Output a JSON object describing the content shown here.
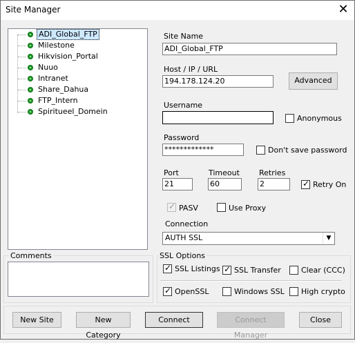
{
  "window": {
    "title": "Site Manager",
    "close_glyph": "✕"
  },
  "tree": {
    "items": [
      {
        "label": "ADI_Global_FTP",
        "selected": true
      },
      {
        "label": "Milestone"
      },
      {
        "label": "Hikvision_Portal"
      },
      {
        "label": "Nuuo"
      },
      {
        "label": "Intranet"
      },
      {
        "label": "Share_Dahua"
      },
      {
        "label": "FTP_Intern"
      },
      {
        "label": "Spiritueel_Domein"
      }
    ]
  },
  "form": {
    "site_name_label": "Site Name",
    "site_name_value": "ADI_Global_FTP",
    "host_label": "Host / IP / URL",
    "host_value": "194.178.124.20",
    "advanced_label": "Advanced",
    "username_label": "Username",
    "username_value": "",
    "anonymous_label": "Anonymous",
    "password_label": "Password",
    "password_value": "*************",
    "dont_save_password_label": "Don't save password",
    "port_label": "Port",
    "port_value": "21",
    "timeout_label": "Timeout",
    "timeout_value": "60",
    "retries_label": "Retries",
    "retries_value": "2",
    "retry_on_label": "Retry On",
    "pasv_label": "PASV",
    "use_proxy_label": "Use Proxy",
    "connection_label": "Connection",
    "connection_value": "AUTH SSL"
  },
  "comments": {
    "label": "Comments",
    "value": ""
  },
  "ssl": {
    "legend": "SSL Options",
    "ssl_listings_label": "SSL Listings",
    "ssl_transfer_label": "SSL Transfer",
    "clear_ccc_label": "Clear (CCC)",
    "openssl_label": "OpenSSL",
    "windows_ssl_label": "Windows SSL",
    "high_crypto_label": "High crypto"
  },
  "buttons": {
    "new_site": "New Site",
    "new_category": "New Category",
    "connect": "Connect",
    "connect_manager": "Connect Manager",
    "close": "Close"
  }
}
